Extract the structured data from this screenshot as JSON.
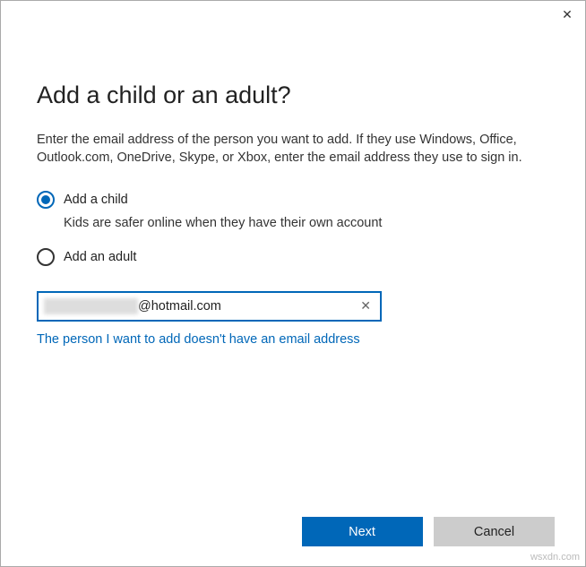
{
  "titlebar": {
    "close_glyph": "✕"
  },
  "page": {
    "title": "Add a child or an adult?",
    "description": "Enter the email address of the person you want to add. If they use Windows, Office, Outlook.com, OneDrive, Skype, or Xbox, enter the email address they use to sign in."
  },
  "options": {
    "child": {
      "label": "Add a child",
      "sub": "Kids are safer online when they have their own account"
    },
    "adult": {
      "label": "Add an adult"
    }
  },
  "email": {
    "domain_part": "@hotmail.com",
    "clear_glyph": "✕"
  },
  "link": {
    "no_email": "The person I want to add doesn't have an email address"
  },
  "buttons": {
    "next": "Next",
    "cancel": "Cancel"
  },
  "watermark": "wsxdn.com"
}
